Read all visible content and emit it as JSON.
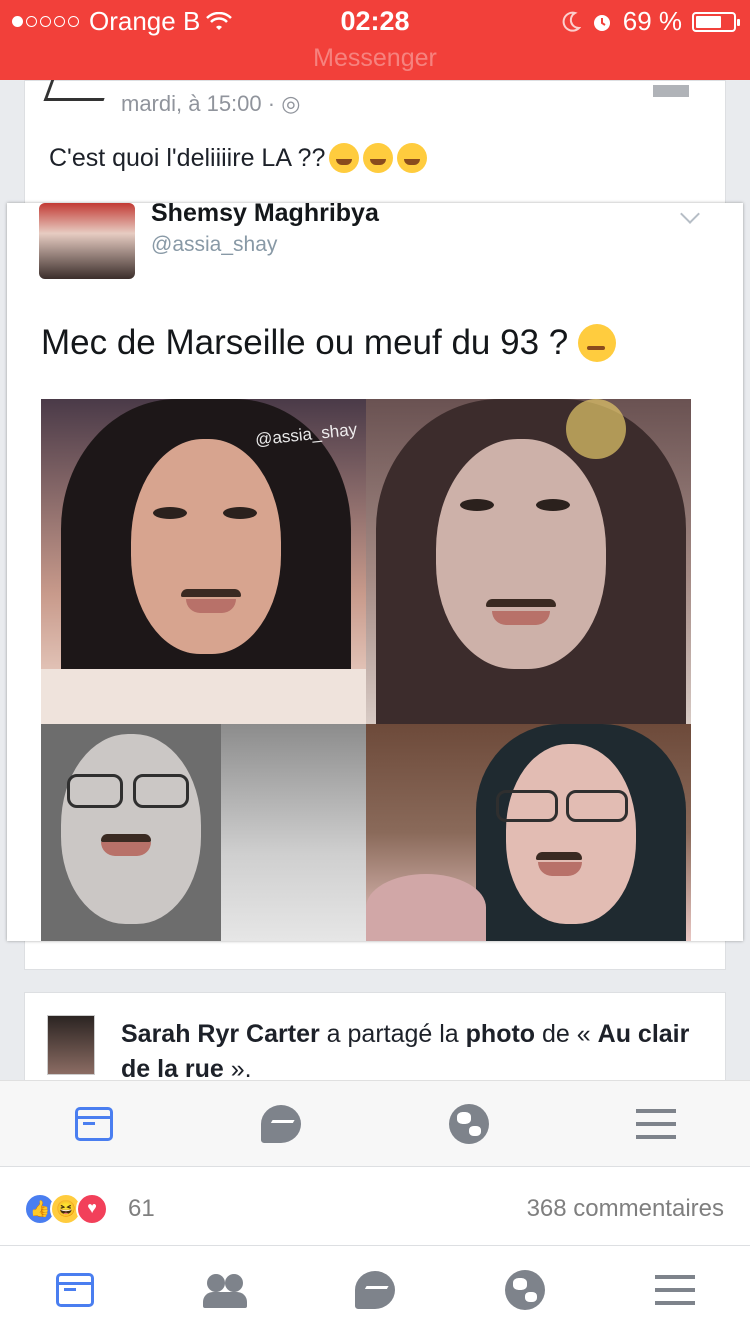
{
  "status_bar": {
    "carrier": "Orange B",
    "time": "02:28",
    "battery": "69 %",
    "battery_level": 0.69,
    "app_name": "Messenger"
  },
  "post": {
    "timestamp": "mardi, à 15:00 · ",
    "text": "C'est quoi l'deliiiire LA ??"
  },
  "tweet": {
    "display_name": "Shemsy Maghribya",
    "handle": "@assia_shay",
    "text": "Mec de Marseille ou meuf du 93 ?",
    "watermark": "@assia_shay"
  },
  "share": {
    "user": "Sarah Ryr Carter",
    "action": " a partagé la ",
    "object": "photo",
    "of": " de « ",
    "page": "Au clair de la rue",
    "end": " »."
  },
  "reactions": {
    "count": "61",
    "comments": "368 commentaires"
  },
  "icons": {
    "inner_tabs": [
      "news-feed-icon",
      "messenger-icon",
      "globe-icon",
      "menu-icon"
    ],
    "outer_tabs": [
      "news-feed-icon",
      "friends-icon",
      "messenger-icon",
      "globe-icon",
      "menu-icon"
    ]
  },
  "colors": {
    "status_bar": "#f2403a",
    "accent_blue": "#4a7ef0",
    "love_red": "#f2405a"
  }
}
